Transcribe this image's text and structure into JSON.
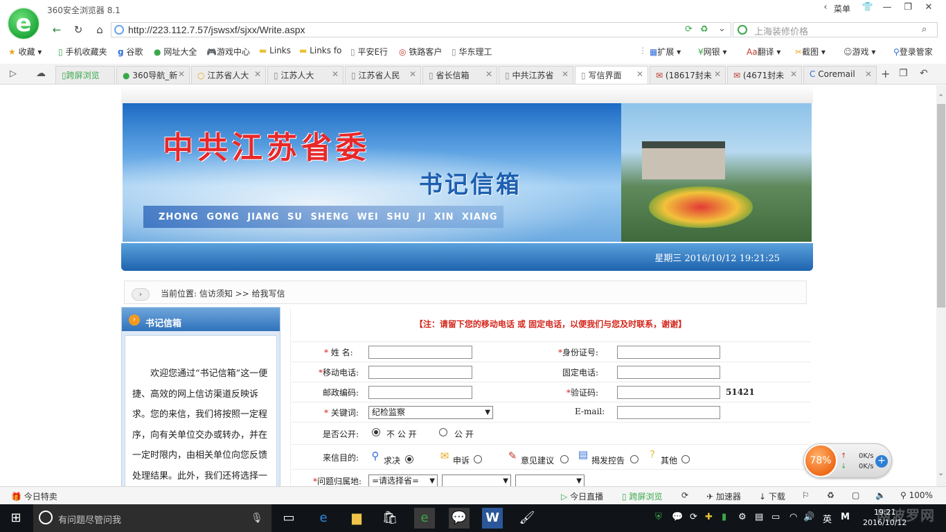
{
  "browser": {
    "app_title": "360安全浏览器 8.1",
    "menu_label": "菜单",
    "url": "http://223.112.7.57/jswsxf/sjxx/Write.aspx",
    "search_placeholder": "上海装修价格"
  },
  "bookmarks": [
    {
      "label": "收藏"
    },
    {
      "label": "手机收藏夹"
    },
    {
      "label": "谷歌"
    },
    {
      "label": "网址大全"
    },
    {
      "label": "游戏中心"
    },
    {
      "label": "Links"
    },
    {
      "label": "Links fo"
    },
    {
      "label": "平安E行"
    },
    {
      "label": "铁路客户"
    },
    {
      "label": "华东理工"
    }
  ],
  "bookmarks_right": [
    {
      "label": "扩展"
    },
    {
      "label": "网银"
    },
    {
      "label": "翻译"
    },
    {
      "label": "截图"
    },
    {
      "label": "游戏"
    },
    {
      "label": "登录管家"
    }
  ],
  "tabs": [
    {
      "label": "跨屏浏览"
    },
    {
      "label": "360导航_新"
    },
    {
      "label": "江苏省人大"
    },
    {
      "label": "江苏人大"
    },
    {
      "label": "江苏省人民"
    },
    {
      "label": "省长信箱"
    },
    {
      "label": "中共江苏省"
    },
    {
      "label": "写信界面"
    },
    {
      "label": "(18617封未"
    },
    {
      "label": "(4671封未"
    },
    {
      "label": "Coremail"
    }
  ],
  "page": {
    "banner_title": "中共江苏省委",
    "banner_subtitle": "书记信箱",
    "banner_pinyin": "ZHONG  GONG  JIANG  SU  SHENG  WEI  SHU  JI  XIN  XIANG",
    "date_text": "星期三  2016/10/12 19:21:25",
    "breadcrumb": "当前位置: 信访须知 >> 给我写信",
    "sidebar_title": "书记信箱",
    "sidebar_text": "欢迎您通过“书记信箱”这一便捷、高效的网上信访渠道反映诉求。您的来信，我们将按照一定程序，向有关单位交办或转办，并在一定时限内，由相关单位向您反馈处理结果。此外，我们还将选择一",
    "notice": "【注：请留下您的移动电话 或 固定电话，以便我们与您及时联系，谢谢】"
  },
  "form": {
    "name_label": "姓  名:",
    "id_label": "身份证号:",
    "mobile_label": "移动电话:",
    "phone_label": "固定电话:",
    "postcode_label": "邮政编码:",
    "captcha_label": "验证码:",
    "captcha_value": "51421",
    "keyword_label": "关键词:",
    "keyword_value": "纪检监察",
    "email_label": "E-mail:",
    "public_label": "是否公开:",
    "public_options": [
      "不 公 开",
      "公 开"
    ],
    "purpose_label": "来信目的:",
    "purpose_options": [
      "求决",
      "申诉",
      "意见建议",
      "揭发控告",
      "其他"
    ],
    "region_label": "问题归属地:",
    "region_value": "=请选择省="
  },
  "widget": {
    "percent": "78%",
    "up": "0K/s",
    "down": "0K/s"
  },
  "statusbar": {
    "left": "今日特卖",
    "live": "今日直播",
    "cross": "跨屏浏览",
    "accel": "加速器",
    "download": "下载",
    "zoom": "100%"
  },
  "taskbar": {
    "search_placeholder": "有问题尽管问我",
    "ime": "英",
    "time": "19:21",
    "date": "2016/10/12",
    "watermark": "网波罗网"
  }
}
